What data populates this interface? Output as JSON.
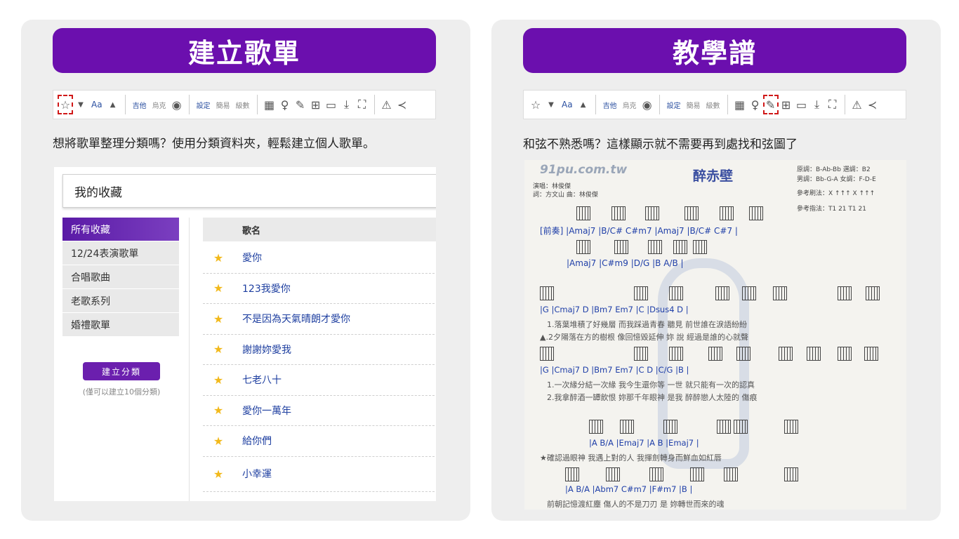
{
  "left": {
    "banner": "建立歌單",
    "caption": "想將歌單整理分類嗎？使用分類資料夾，輕鬆建立個人歌單。",
    "favorites_title": "我的收藏",
    "sidebar": [
      "所有收藏",
      "12/24表演歌單",
      "合唱歌曲",
      "老歌系列",
      "婚禮歌單"
    ],
    "create_button": "建立分類",
    "create_note": "(僅可以建立10個分類)",
    "song_header": "歌名",
    "songs": [
      "愛你",
      "123我愛你",
      "不是因為天氣晴朗才愛你",
      "謝謝妳愛我",
      "七老八十",
      "愛你一萬年",
      "給你們",
      "小幸運"
    ]
  },
  "toolbar": {
    "font": "Aa",
    "guitar": "吉他",
    "ukulele": "烏克",
    "toggle": "設定",
    "simple": "簡易",
    "level": "級數"
  },
  "right": {
    "banner": "教學譜",
    "caption": "和弦不熟悉嗎？這樣顯示就不需要再到處找和弦圖了",
    "watermark": "91pu.com.tw",
    "song_title": "醉赤壁",
    "singer": "演唱：林俊傑",
    "credits": "詞：方文山  曲：林俊傑",
    "key_info": "原調：B-Ab-Bb  選調：B2",
    "key_info2": "男調：Bb-G-A  女調：F-D-E",
    "strum": "參考刷法：X ↑↑↑ X ↑↑↑",
    "finger": "參考指法：T1 21 T1 21",
    "chord_lines": [
      "[前奏] |Amaj7   |B/C#   C#m7   |Amaj7   |B/C#   C#7   |",
      "|Amaj7   |C#m9   |D/G   |B   A/B   |",
      "|G                    |Cmaj7     D          |Bm7   Em7   |C              |Dsus4   D   |",
      "|G                    |Cmaj7     D          |Bm7   Em7   |C      D      |C/G    |B   |",
      "|A        B/A        |Emaj7          |A     B           |Emaj7     |",
      "|A          B/A      |Abm7    C#m7   |F#m7               |B   |"
    ],
    "lyric_lines": [
      "1.落葉堆積了好幾層      而我踩過青春      聽見      前世誰在淚語紛紛",
      "▲.2夕陽落在方的樹根      像回憶毀延伸      妳 說      經過是誰的心就聲",
      "1.一次緣分結一次緣      我今生還你等      一世      就只能有一次的認真",
      "2.我拿醉酒一罈飲恨      妳那千年眼神      是我      醉醉戀人太陸的 傷痕",
      "★確認過眼神      我遇上對的人      我揮劍轉身而鮮血如紅唇",
      "前朝記憶渡紅塵      傷人的不是刀刃      是 妳轉世而來的魂"
    ]
  }
}
